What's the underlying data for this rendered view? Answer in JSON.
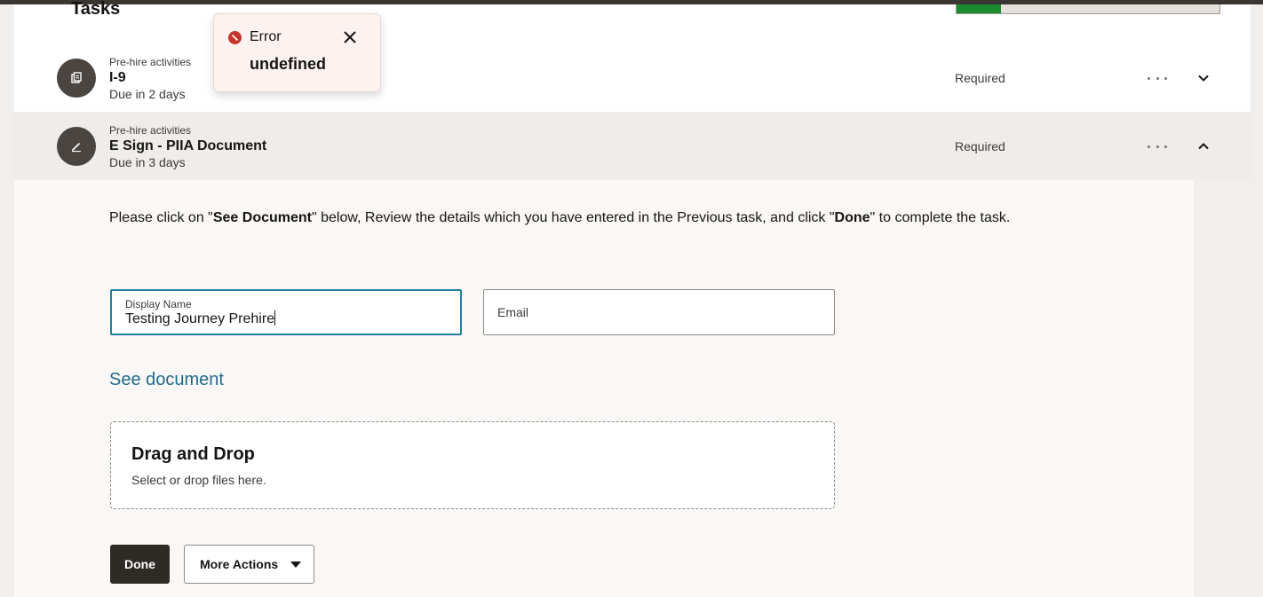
{
  "page": {
    "title": "Tasks",
    "progress_fraction": 0.17,
    "colors": {
      "progress": "#1a8a2e",
      "link": "#1f6b8a",
      "error": "#c7352b",
      "focus": "#227e9e"
    }
  },
  "toast": {
    "icon": "error-icon",
    "title": "Error",
    "message": "undefined",
    "close_icon": "close-icon"
  },
  "tasks": [
    {
      "category": "Pre-hire activities",
      "name": "I-9",
      "due": "Due in 2 days",
      "status": "Required",
      "icon": "document-icon",
      "expanded": false
    },
    {
      "category": "Pre-hire activities",
      "name": "E Sign - PIIA Document",
      "due": "Due in 3 days",
      "status": "Required",
      "icon": "pen-icon",
      "expanded": true
    }
  ],
  "detail": {
    "instruction_parts": [
      "Please click on \"",
      "See Document",
      "\" below, Review the details which you have entered in the Previous task, and click \"",
      "Done",
      "\" to complete the task."
    ],
    "display_name_label": "Display Name",
    "display_name_value": "Testing Journey Prehire",
    "email_placeholder": "Email",
    "see_document_link": "See document",
    "dropzone_title": "Drag and Drop",
    "dropzone_sub": "Select or drop files here.",
    "done_button": "Done",
    "more_actions_button": "More Actions"
  }
}
